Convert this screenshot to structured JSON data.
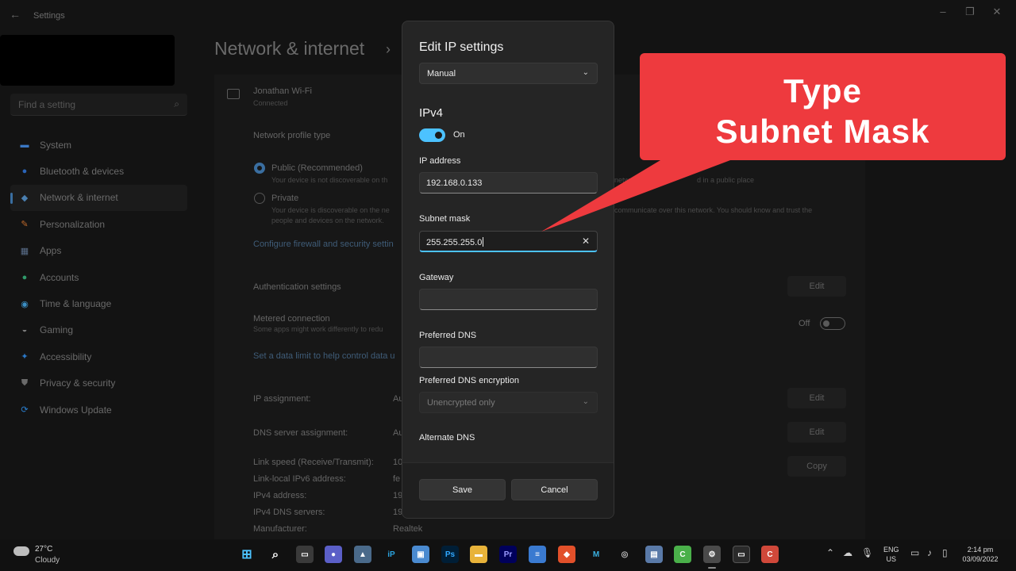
{
  "app": {
    "title": "Settings"
  },
  "sidebar": {
    "search_placeholder": "Find a setting",
    "items": [
      {
        "label": "System",
        "color": "#3b78c4"
      },
      {
        "label": "Bluetooth & devices",
        "color": "#2a64b8"
      },
      {
        "label": "Network & internet",
        "color": "#4a7fb0",
        "active": true
      },
      {
        "label": "Personalization",
        "color": "#c06a2b"
      },
      {
        "label": "Apps",
        "color": "#5a6e8a"
      },
      {
        "label": "Accounts",
        "color": "#2f9a6a"
      },
      {
        "label": "Time & language",
        "color": "#3b8fc4"
      },
      {
        "label": "Gaming",
        "color": "#7a7a7a"
      },
      {
        "label": "Accessibility",
        "color": "#2a78c8"
      },
      {
        "label": "Privacy & security",
        "color": "#6a6a6a"
      },
      {
        "label": "Windows Update",
        "color": "#2a7fd0"
      }
    ]
  },
  "page": {
    "heading": "Network & internet",
    "wifi_name": "Jonathan Wi-Fi",
    "wifi_status": "Connected",
    "profile_type_label": "Network profile type",
    "public_label": "Public (Recommended)",
    "public_desc": "Your device is not discoverable on th",
    "public_desc_tail": "netw",
    "public_desc_right": "d in a public place",
    "private_label": "Private",
    "private_desc": "Your device is discoverable on the ne",
    "private_desc_right": "communicate over this network. You should know and trust the",
    "private_desc2": "people and devices on the network.",
    "firewall_link": "Configure firewall and security settin",
    "auth_label": "Authentication settings",
    "metered_label": "Metered connection",
    "metered_desc": "Some apps might work differently to redu",
    "metered_state": "Off",
    "data_limit_link": "Set a data limit to help control data u",
    "ip_assign_label": "IP assignment:",
    "ip_assign_val": "Au",
    "dns_assign_label": "DNS server assignment:",
    "dns_assign_val": "Au",
    "link_speed_label": "Link speed (Receive/Transmit):",
    "link_speed_val": "10",
    "ipv6_label": "Link-local IPv6 address:",
    "ipv6_val": "fe",
    "ipv4_label": "IPv4 address:",
    "ipv4_val": "19",
    "ipv4dns_label": "IPv4 DNS servers:",
    "ipv4dns_val": "19",
    "manufacturer_label": "Manufacturer:",
    "manufacturer_val": "Realtek",
    "edit_label": "Edit",
    "copy_label": "Copy"
  },
  "dialog": {
    "title": "Edit IP settings",
    "mode": "Manual",
    "section": "IPv4",
    "toggle_state": "On",
    "ip_label": "IP address",
    "ip_value": "192.168.0.133",
    "subnet_label": "Subnet mask",
    "subnet_value": "255.255.255.0",
    "gateway_label": "Gateway",
    "gateway_value": "",
    "dns_label": "Preferred DNS",
    "dns_value": "",
    "dns_enc_label": "Preferred DNS encryption",
    "dns_enc_value": "Unencrypted only",
    "alt_dns_label": "Alternate DNS",
    "save_label": "Save",
    "cancel_label": "Cancel"
  },
  "callout": {
    "line1": "Type",
    "line2": "Subnet Mask",
    "color": "#ee3a3e"
  },
  "taskbar": {
    "temperature": "27°C",
    "weather": "Cloudy",
    "lang1": "ENG",
    "lang2": "US",
    "time": "2:14 pm",
    "date": "03/09/2022"
  }
}
